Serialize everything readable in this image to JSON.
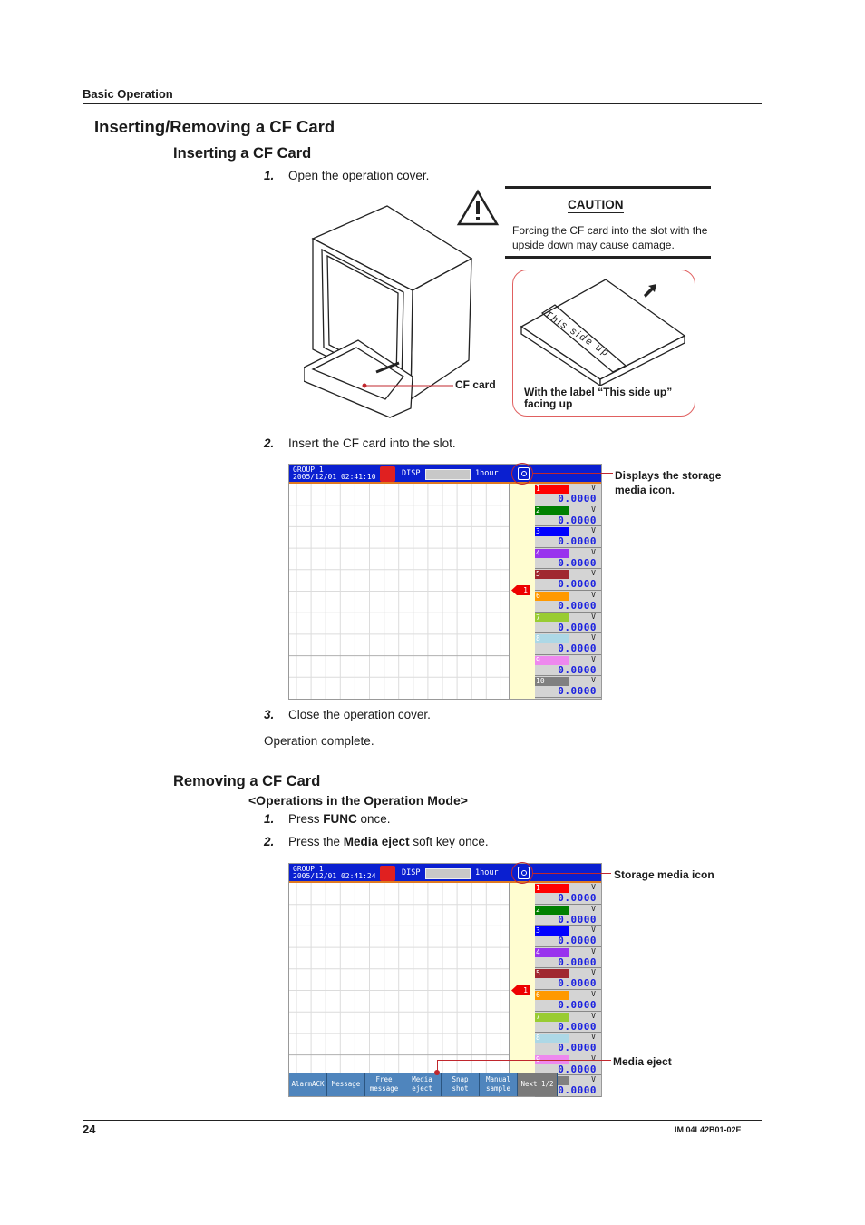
{
  "header": {
    "section": "Basic Operation"
  },
  "title": "Inserting/Removing a CF Card",
  "inserting": {
    "heading": "Inserting a CF Card",
    "steps": [
      {
        "num": "1.",
        "text": "Open the operation cover."
      },
      {
        "num": "2.",
        "text": "Insert the CF card into the slot."
      },
      {
        "num": "3.",
        "text": "Close the operation cover."
      }
    ],
    "complete": "Operation complete.",
    "cf_card_label": "CF card",
    "caution": {
      "title": "CAUTION",
      "text": "Forcing the CF card into the slot with the upside down may cause damage."
    },
    "card_label_text": "This side up",
    "card_caption": "With the label “This side up” facing up",
    "screen_callout": "Displays the storage media icon."
  },
  "removing": {
    "heading": "Removing a CF Card",
    "subheading": "<Operations in the Operation Mode>",
    "steps": [
      {
        "num": "1.",
        "pre": "Press ",
        "bold": "FUNC",
        "post": " once."
      },
      {
        "num": "2.",
        "pre": "Press the ",
        "bold": "Media eject",
        "post": " soft key once."
      }
    ],
    "callout_media_icon": "Storage media icon",
    "callout_media_eject": "Media eject"
  },
  "screen1": {
    "group": "GROUP 1",
    "datetime": "2005/12/01 02:41:10",
    "mode": "DISP",
    "span": "1hour",
    "marker": "1"
  },
  "screen2": {
    "group": "GROUP 1",
    "datetime": "2005/12/01 02:41:24",
    "mode": "DISP",
    "span": "1hour",
    "marker": "1",
    "softkeys": [
      "AlarmACK",
      "Message",
      "Free\nmessage",
      "Media\neject",
      "Snap\nshot",
      "Manual\nsample",
      "Next 1/2"
    ]
  },
  "channels": [
    {
      "id": "1",
      "color": "#ff0000",
      "unit": "V",
      "value": "0.0000"
    },
    {
      "id": "2",
      "color": "#008000",
      "unit": "V",
      "value": "0.0000"
    },
    {
      "id": "3",
      "color": "#0000ff",
      "unit": "V",
      "value": "0.0000"
    },
    {
      "id": "4",
      "color": "#9933ee",
      "unit": "V",
      "value": "0.0000"
    },
    {
      "id": "5",
      "color": "#a02830",
      "unit": "V",
      "value": "0.0000"
    },
    {
      "id": "6",
      "color": "#ff9900",
      "unit": "V",
      "value": "0.0000"
    },
    {
      "id": "7",
      "color": "#99cc33",
      "unit": "V",
      "value": "0.0000"
    },
    {
      "id": "8",
      "color": "#add8e6",
      "unit": "V",
      "value": "0.0000"
    },
    {
      "id": "9",
      "color": "#ee88ee",
      "unit": "V",
      "value": "0.0000"
    },
    {
      "id": "10",
      "color": "#808080",
      "unit": "V",
      "value": "0.0000"
    }
  ],
  "footer": {
    "page": "24",
    "doc_id": "IM 04L42B01-02E"
  }
}
